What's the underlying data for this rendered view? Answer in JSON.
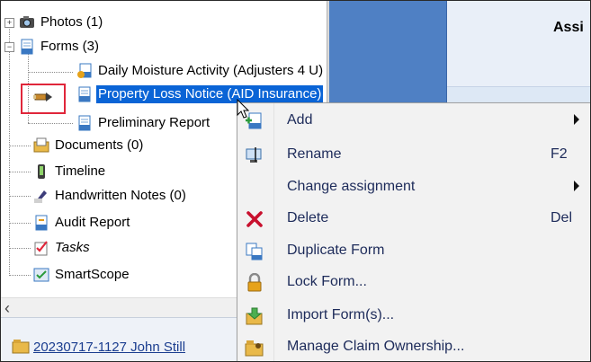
{
  "tree": {
    "items": [
      {
        "label": "Photos (1)",
        "icon": "camera-icon"
      },
      {
        "label": "Forms (3)",
        "icon": "form-document-icon"
      },
      {
        "label": "Daily Moisture Activity (Adjusters 4 U)",
        "icon": "form-shared-icon"
      },
      {
        "label": "Property Loss Notice (AID Insurance)",
        "icon": "form-document-icon"
      },
      {
        "label": "Preliminary Report",
        "icon": "form-document-icon"
      },
      {
        "label": "Documents (0)",
        "icon": "folder-documents-icon"
      },
      {
        "label": "Timeline",
        "icon": "timeline-icon"
      },
      {
        "label": "Handwritten Notes (0)",
        "icon": "pen-notes-icon"
      },
      {
        "label": "Audit Report",
        "icon": "audit-report-icon"
      },
      {
        "label": "Tasks",
        "icon": "tasks-checklist-icon"
      },
      {
        "label": "SmartScope",
        "icon": "smartscope-icon"
      }
    ]
  },
  "right_header": "Assi",
  "claim_footer": {
    "label": "20230717-1127 John Still"
  },
  "context_menu": {
    "items": [
      {
        "label": "Add",
        "shortcut": "",
        "submenu": true,
        "icon": "add-form-icon"
      },
      {
        "label": "Rename",
        "shortcut": "F2",
        "submenu": false,
        "icon": "rename-icon"
      },
      {
        "label": "Change assignment",
        "shortcut": "",
        "submenu": true,
        "icon": ""
      },
      {
        "label": "Delete",
        "shortcut": "Del",
        "submenu": false,
        "icon": "delete-x-icon"
      },
      {
        "label": "Duplicate Form",
        "shortcut": "",
        "submenu": false,
        "icon": "duplicate-icon"
      },
      {
        "label": "Lock Form...",
        "shortcut": "",
        "submenu": false,
        "icon": "lock-icon"
      },
      {
        "label": "Import Form(s)...",
        "shortcut": "",
        "submenu": false,
        "icon": "import-icon"
      },
      {
        "label": "Manage Claim Ownership...",
        "shortcut": "",
        "submenu": false,
        "icon": "claim-ownership-icon"
      }
    ]
  },
  "colors": {
    "selection": "#0a64d6",
    "highlight_box": "#e0263a",
    "menu_text": "#1d2b5a"
  }
}
